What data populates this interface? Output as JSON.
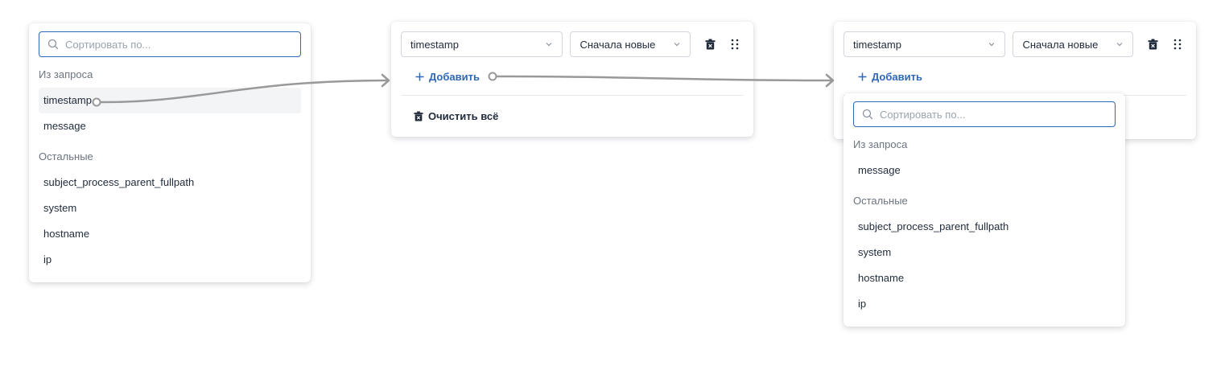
{
  "left_dropdown": {
    "search_placeholder": "Сортировать по...",
    "section_query": "Из запроса",
    "query_items": [
      "timestamp",
      "message"
    ],
    "section_other": "Остальные",
    "other_items": [
      "subject_process_parent_fullpath",
      "system",
      "hostname",
      "ip"
    ]
  },
  "middle_panel": {
    "field_value": "timestamp",
    "order_value": "Сначала новые",
    "add_label": "Добавить",
    "clear_label": "Очистить всё"
  },
  "right_panel": {
    "field_value": "timestamp",
    "order_value": "Сначала новые",
    "add_label": "Добавить"
  },
  "right_dropdown": {
    "search_placeholder": "Сортировать по...",
    "section_query": "Из запроса",
    "query_items": [
      "message"
    ],
    "section_other": "Остальные",
    "other_items": [
      "subject_process_parent_fullpath",
      "system",
      "hostname",
      "ip"
    ]
  },
  "colors": {
    "accent": "#2f67b9",
    "text": "#1f2a3a",
    "muted": "#6b7480",
    "connector": "#999999"
  },
  "icons": {
    "search": "search-icon",
    "chevron": "chevron-down-icon",
    "delete": "trash-icon",
    "drag": "drag-handle-icon",
    "add": "plus-icon"
  }
}
